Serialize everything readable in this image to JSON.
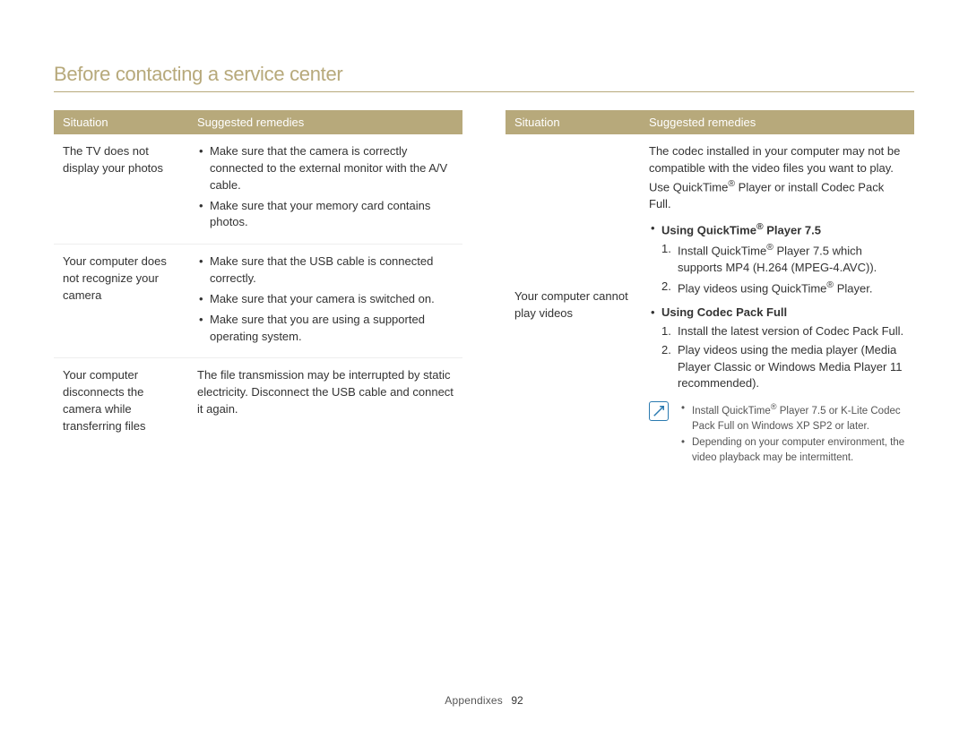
{
  "page_title": "Before contacting a service center",
  "headers": {
    "situation": "Situation",
    "remedies": "Suggested remedies"
  },
  "left_table": [
    {
      "situation": "The TV does not display your photos",
      "bullets": [
        "Make sure that the camera is correctly connected to the external monitor with the A/V cable.",
        "Make sure that your memory card contains photos."
      ]
    },
    {
      "situation": "Your computer does not recognize your camera",
      "bullets": [
        "Make sure that the USB cable is connected correctly.",
        "Make sure that your camera is switched on.",
        "Make sure that you are using a supported operating system."
      ]
    },
    {
      "situation": "Your computer disconnects the camera while transferring files",
      "text": "The file transmission may be interrupted by static electricity. Disconnect the USB cable and connect it again."
    }
  ],
  "right_table": {
    "situation": "Your computer cannot play videos",
    "intro_html": "The codec installed in your computer may not be compatible with the video files you want to play. Use QuickTime<span class=\"reg\">®</span> Player or install Codec Pack Full.",
    "sections": [
      {
        "heading_html": "Using QuickTime<span class=\"reg\">®</span> Player 7.5",
        "steps_html": [
          "Install QuickTime<span class=\"reg\">®</span> Player 7.5 which supports MP4 (H.264 (MPEG-4.AVC)).",
          "Play videos using QuickTime<span class=\"reg\">®</span> Player."
        ]
      },
      {
        "heading_html": "Using Codec Pack Full",
        "steps_html": [
          "Install the latest version of Codec Pack Full.",
          "Play videos using the media player (Media Player Classic or Windows Media Player 11 recommended)."
        ]
      }
    ],
    "note_bullets_html": [
      "Install QuickTime<span class=\"reg\">®</span> Player 7.5 or K-Lite Codec Pack Full on Windows XP SP2 or later.",
      "Depending on your computer environment, the video playback may be intermittent."
    ]
  },
  "footer": {
    "section": "Appendixes",
    "page": "92"
  }
}
